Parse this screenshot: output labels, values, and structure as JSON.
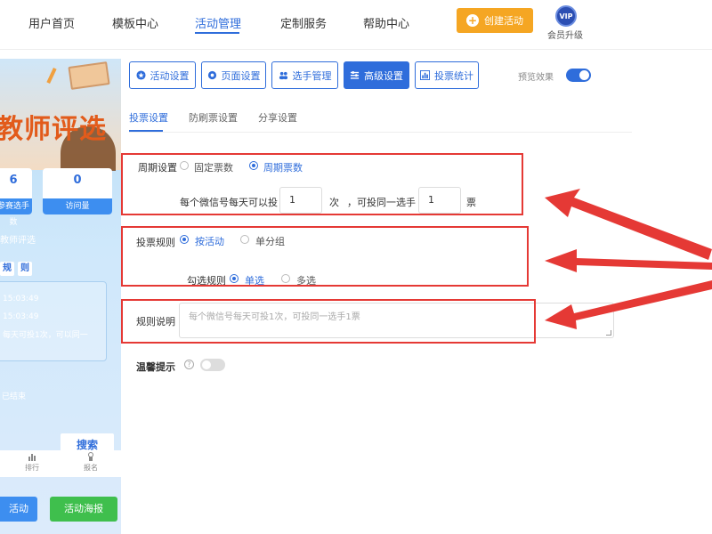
{
  "nav": {
    "items": [
      "用户首页",
      "模板中心",
      "活动管理",
      "定制服务",
      "帮助中心"
    ],
    "active_index": 2,
    "create_label": "创建活动",
    "vip_badge": "VIP",
    "vip_label": "会员升级"
  },
  "preview": {
    "title": "教师评选",
    "stats": [
      {
        "value": "6",
        "label": "参赛选手数"
      },
      {
        "value": "0",
        "label": "访问量"
      }
    ],
    "name": "教师评选",
    "tabs": [
      "规",
      "则"
    ],
    "lines": [
      "15:03:49",
      "15:03:49",
      "每天可投1次，可以同一",
      "已结束"
    ],
    "search_label": "搜索",
    "bottom_items": [
      "排行",
      "报名"
    ],
    "btn_activity": "活动",
    "btn_poster": "活动海报"
  },
  "settings_tabs": [
    "活动设置",
    "页面设置",
    "选手管理",
    "高级设置",
    "投票统计"
  ],
  "settings_active": 3,
  "preview_effect_label": "预览效果",
  "subtabs": [
    "投票设置",
    "防刷票设置",
    "分享设置"
  ],
  "form": {
    "cycle": {
      "label": "周期设置",
      "options": [
        "固定票数",
        "周期票数"
      ],
      "selected": 1,
      "per_day_prefix": "每个微信号每天可以投",
      "times_value": "1",
      "times_unit": "次",
      "same_player_text": "，可投同一选手",
      "votes_value": "1",
      "votes_unit": "票"
    },
    "rule": {
      "label": "投票规则",
      "options": [
        "按活动",
        "单分组"
      ],
      "selected": 0,
      "check_label": "勾选规则",
      "check_options": [
        "单选",
        "多选"
      ],
      "check_selected": 0
    },
    "description": {
      "label": "规则说明",
      "placeholder": "每个微信号每天可投1次，可投同一选手1票"
    },
    "tips": {
      "label": "温馨提示",
      "help": "?"
    }
  },
  "colors": {
    "accent": "#2f6ddb",
    "create": "#f5a623",
    "highlight": "#e53935",
    "poster": "#3fbf4d"
  }
}
